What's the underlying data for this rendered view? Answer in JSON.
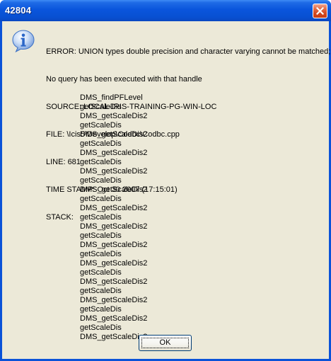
{
  "window": {
    "title": "42804"
  },
  "icons": {
    "title_close": "close-icon",
    "message": "info-icon"
  },
  "message": {
    "error": "ERROR: UNION types double precision and character varying cannot be matched;",
    "detail": "No query has been executed with that handle",
    "source": "SOURCE: LOCAL-IRIS-TRAINING-PG-WIN-LOC",
    "file": "FILE: \\Icis5\\Develop\\Codbc\\Codbc.cpp",
    "line": "LINE: 681",
    "timestamp": "TIME STAMP: Oct 30 2007 (17:15:01)",
    "stack_label": "STACK:"
  },
  "stack": [
    "DMS_findPFLevel",
    "getScaleDis",
    "DMS_getScaleDis2",
    "getScaleDis",
    "DMS_getScaleDis2",
    "getScaleDis",
    "DMS_getScaleDis2",
    "getScaleDis",
    "DMS_getScaleDis2",
    "getScaleDis",
    "DMS_getScaleDis2",
    "getScaleDis",
    "DMS_getScaleDis2",
    "getScaleDis",
    "DMS_getScaleDis2",
    "getScaleDis",
    "DMS_getScaleDis2",
    "getScaleDis",
    "DMS_getScaleDis2",
    "getScaleDis",
    "DMS_getScaleDis2",
    "getScaleDis",
    "DMS_getScaleDis2",
    "getScaleDis",
    "DMS_getScaleDis2",
    "getScaleDis",
    "DMS_getScaleDis2"
  ],
  "buttons": {
    "ok": "OK"
  },
  "colors": {
    "titlebar": "#0a55dc",
    "dialog_face": "#ece9d8",
    "close_button": "#d2461e",
    "info_icon": "#2a66c8"
  }
}
